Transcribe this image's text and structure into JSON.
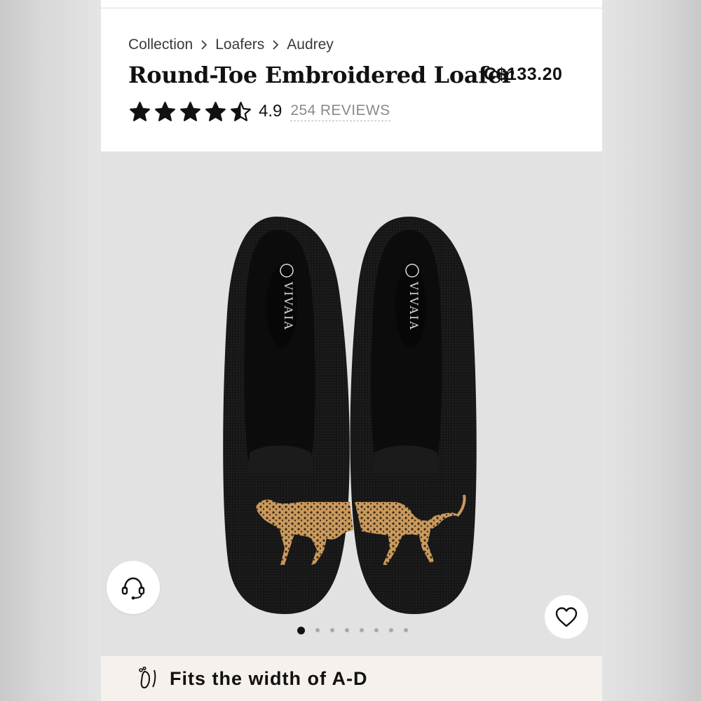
{
  "breadcrumb": {
    "items": [
      "Collection",
      "Loafers",
      "Audrey"
    ]
  },
  "product": {
    "title": "Round-Toe Embroidered Loafer",
    "price": "C$133.20",
    "rating": "4.9",
    "rating_stars": 4.5,
    "reviews": "254 REVIEWS"
  },
  "gallery": {
    "brand_text": "VIVAIA",
    "image_count": 8,
    "active_index": 0,
    "icons": [
      "headset-icon",
      "heart-icon"
    ]
  },
  "fit_banner": {
    "text": "Fits the width of A-D",
    "icon": "footprint-icon"
  },
  "colors": {
    "shoe": "#141414",
    "embroidery": "#c9a06a",
    "gallery_bg": "#e2e2e2",
    "banner_bg": "#f6f1ec"
  }
}
